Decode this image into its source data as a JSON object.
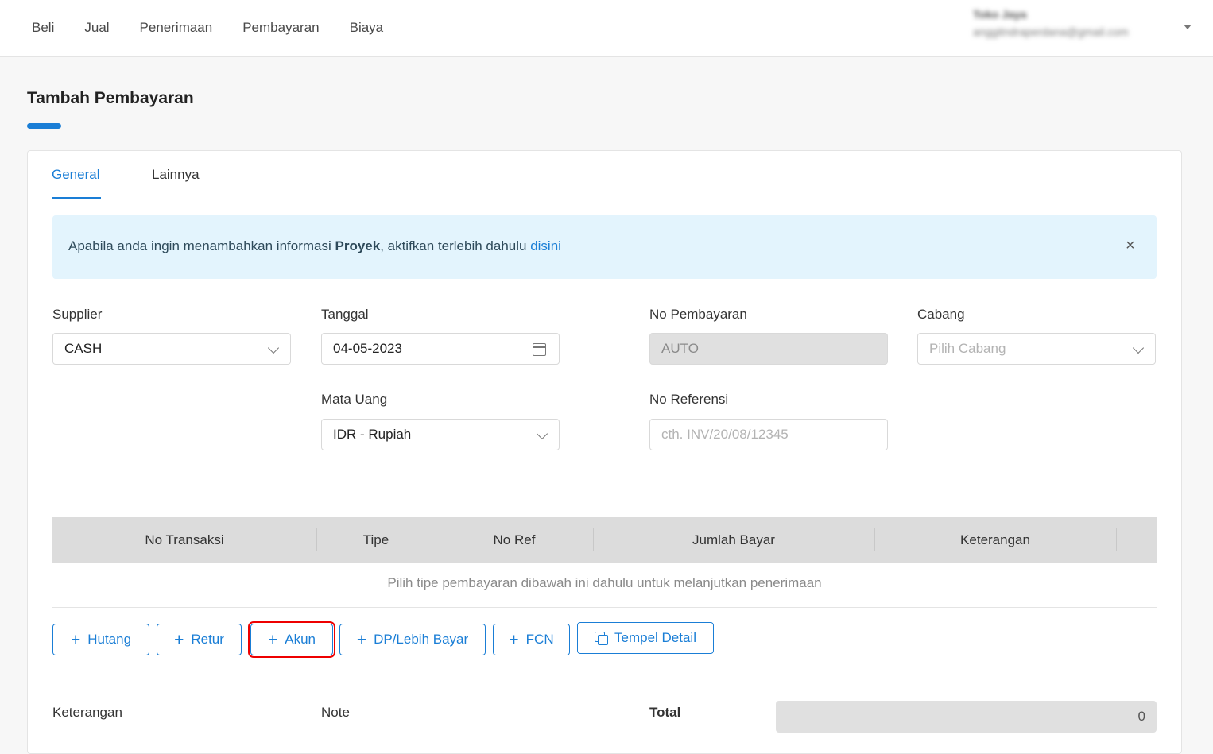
{
  "nav": {
    "items": [
      "Beli",
      "Jual",
      "Penerimaan",
      "Pembayaran",
      "Biaya"
    ]
  },
  "user": {
    "name": "Toko Jaya",
    "email": "anggitndraperdana@gmail.com"
  },
  "page": {
    "title": "Tambah Pembayaran"
  },
  "tabs": [
    "General",
    "Lainnya"
  ],
  "alert": {
    "text_before": "Apabila anda ingin menambahkan informasi ",
    "bold": "Proyek",
    "text_after": ", aktifkan terlebih dahulu ",
    "link": "disini",
    "close": "×"
  },
  "form": {
    "supplier": {
      "label": "Supplier",
      "value": "CASH"
    },
    "tanggal": {
      "label": "Tanggal",
      "value": "04-05-2023"
    },
    "no_pembayaran": {
      "label": "No Pembayaran",
      "value": "AUTO"
    },
    "cabang": {
      "label": "Cabang",
      "placeholder": "Pilih Cabang"
    },
    "mata_uang": {
      "label": "Mata Uang",
      "value": "IDR - Rupiah"
    },
    "no_referensi": {
      "label": "No Referensi",
      "placeholder": "cth. INV/20/08/12345"
    }
  },
  "table": {
    "columns": [
      "No Transaksi",
      "Tipe",
      "No Ref",
      "Jumlah Bayar",
      "Keterangan"
    ],
    "empty_message": "Pilih tipe pembayaran dibawah ini dahulu untuk melanjutkan penerimaan"
  },
  "buttons": {
    "hutang": "Hutang",
    "retur": "Retur",
    "akun": "Akun",
    "dp": "DP/Lebih Bayar",
    "fcn": "FCN",
    "tempel": "Tempel Detail"
  },
  "footer": {
    "keterangan": "Keterangan",
    "note": "Note",
    "total": "Total",
    "total_value": "0"
  },
  "colors": {
    "accent": "#1a7ed6",
    "alert_bg": "#e3f4fd",
    "highlight": "#e00000"
  }
}
